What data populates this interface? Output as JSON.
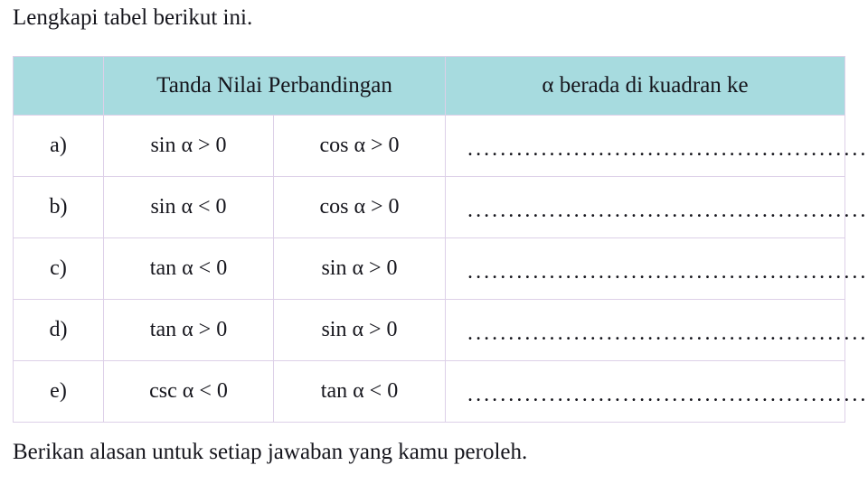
{
  "intro": {
    "text": "Lengkapi tabel berikut ini."
  },
  "outro": {
    "text": "Berikan alasan untuk setiap jawaban yang kamu peroleh."
  },
  "colors": {
    "header_background": "#a7dbdf",
    "border": "#ddd0e8",
    "text": "#15151c",
    "page_background": "#ffffff"
  },
  "table": {
    "headers": {
      "label_column": "",
      "condition_column": "Tanda Nilai Perbandingan",
      "answer_column": "α berada di kuadran ke"
    },
    "rows": [
      {
        "label": "a)",
        "condition_1": "sin α > 0",
        "condition_2": "cos α > 0",
        "answer": "......................................................."
      },
      {
        "label": "b)",
        "condition_1": "sin α < 0",
        "condition_2": "cos α > 0",
        "answer": "......................................................."
      },
      {
        "label": "c)",
        "condition_1": "tan α < 0",
        "condition_2": "sin α > 0",
        "answer": "......................................................."
      },
      {
        "label": "d)",
        "condition_1": "tan α > 0",
        "condition_2": "sin α > 0",
        "answer": "......................................................."
      },
      {
        "label": "e)",
        "condition_1": "csc α < 0",
        "condition_2": "tan α < 0",
        "answer": "......................................................."
      }
    ]
  }
}
